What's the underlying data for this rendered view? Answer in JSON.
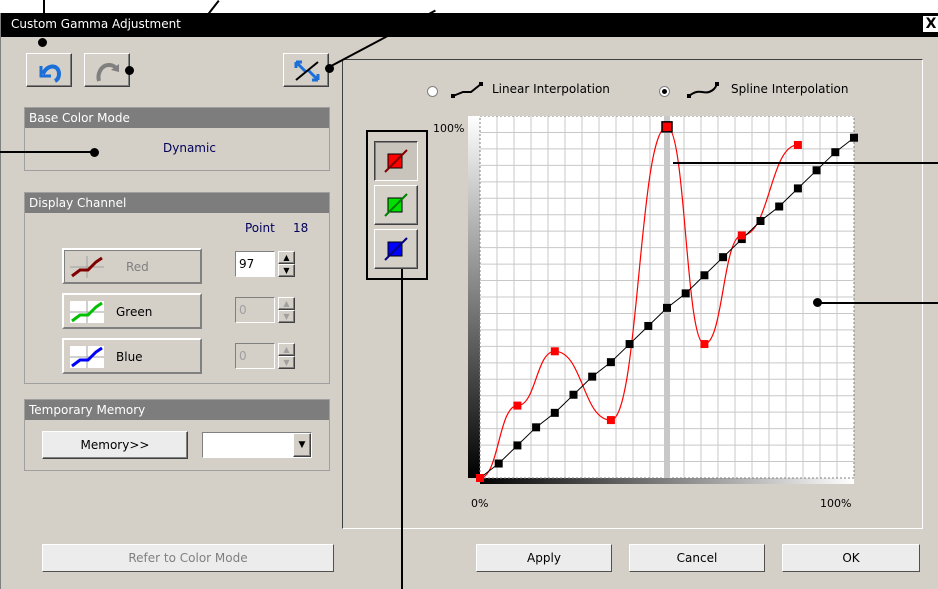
{
  "window": {
    "title": "Custom Gamma Adjustment",
    "close_glyph": "X"
  },
  "toolbar": {
    "undo_icon": "undo-icon",
    "redo_icon": "redo-icon",
    "reset_icon": "reset-curve-icon"
  },
  "base_color_mode": {
    "header": "Base Color Mode",
    "value": "Dynamic"
  },
  "display_channel": {
    "header": "Display Channel",
    "point_label": "Point",
    "point_value": "18",
    "channels": [
      {
        "label": "Red",
        "value": "97"
      },
      {
        "label": "Green",
        "value": "0"
      },
      {
        "label": "Blue",
        "value": "0"
      }
    ]
  },
  "temporary_memory": {
    "header": "Temporary Memory",
    "memory_button": "Memory>>",
    "select_value": ""
  },
  "refer_button": "Refer to Color Mode",
  "interpolation": {
    "linear_label": "Linear Interpolation",
    "spline_label": "Spline Interpolation",
    "selected": "spline"
  },
  "graph_axis": {
    "y_top": "100%",
    "x_left": "0%",
    "x_right": "100%"
  },
  "dialog_buttons": {
    "apply": "Apply",
    "cancel": "Cancel",
    "ok": "OK"
  },
  "colors": {
    "red": "#ff0000",
    "green": "#00c000",
    "blue": "#0000ff",
    "header_bg": "#7d7d7d",
    "face": "#d4d0c8"
  },
  "curve": {
    "selected_index": 10,
    "linear_points": [
      [
        0,
        0
      ],
      [
        5,
        4
      ],
      [
        10,
        9
      ],
      [
        15,
        14
      ],
      [
        20,
        18
      ],
      [
        25,
        23
      ],
      [
        30,
        28
      ],
      [
        35,
        32
      ],
      [
        40,
        37
      ],
      [
        45,
        42
      ],
      [
        50,
        47
      ],
      [
        55,
        51
      ],
      [
        60,
        56
      ],
      [
        65,
        61
      ],
      [
        70,
        66
      ],
      [
        75,
        71
      ],
      [
        80,
        75
      ],
      [
        85,
        80
      ],
      [
        90,
        85
      ],
      [
        95,
        90
      ],
      [
        100,
        94
      ]
    ],
    "red_points": [
      [
        0,
        0
      ],
      [
        10,
        20
      ],
      [
        20,
        35
      ],
      [
        35,
        16
      ],
      [
        50,
        97
      ],
      [
        60,
        37
      ],
      [
        70,
        67
      ],
      [
        85,
        92
      ]
    ]
  }
}
